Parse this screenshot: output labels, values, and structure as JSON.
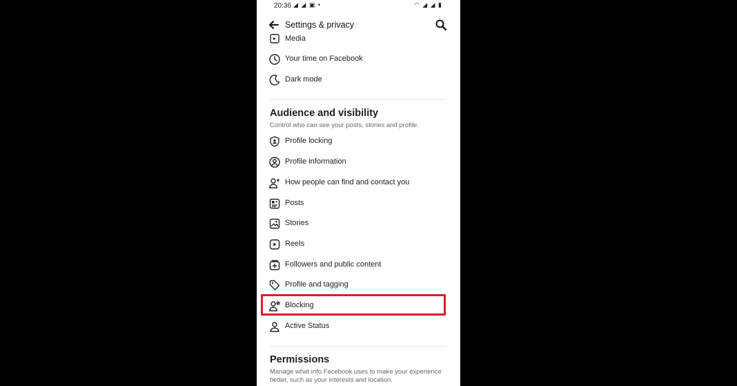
{
  "status_bar": {
    "time": "20:36",
    "left_icons": "◢ ◢ ▣ •",
    "right_icons": "◠ ◢ ◢ ▮"
  },
  "header": {
    "title": "Settings & privacy",
    "back_icon": "arrow-left-icon",
    "search_icon": "search-icon"
  },
  "top_items": [
    {
      "label": "Media",
      "icon": "media-icon"
    },
    {
      "label": "Your time on Facebook",
      "icon": "clock-icon"
    },
    {
      "label": "Dark mode",
      "icon": "moon-icon"
    }
  ],
  "audience": {
    "title": "Audience and visibility",
    "description": "Control who can see your posts, stories and profile.",
    "items": [
      {
        "label": "Profile locking",
        "icon": "shield-user-icon"
      },
      {
        "label": "Profile information",
        "icon": "user-circle-icon"
      },
      {
        "label": "How people can find and contact you",
        "icon": "user-plus-icon"
      },
      {
        "label": "Posts",
        "icon": "posts-icon"
      },
      {
        "label": "Stories",
        "icon": "stories-icon"
      },
      {
        "label": "Reels",
        "icon": "reels-icon"
      },
      {
        "label": "Followers and public content",
        "icon": "followers-icon"
      },
      {
        "label": "Profile and tagging",
        "icon": "tag-icon"
      },
      {
        "label": "Blocking",
        "icon": "user-block-icon"
      },
      {
        "label": "Active Status",
        "icon": "user-status-icon"
      }
    ]
  },
  "permissions": {
    "title": "Permissions",
    "description": "Manage what info Facebook uses to make your experience better, such as your interests and location."
  },
  "colors": {
    "highlight": "#d3222c",
    "text": "#1c1e21",
    "secondary_text": "#65676b",
    "background_outer": "#000000",
    "background_phone": "#ffffff"
  }
}
